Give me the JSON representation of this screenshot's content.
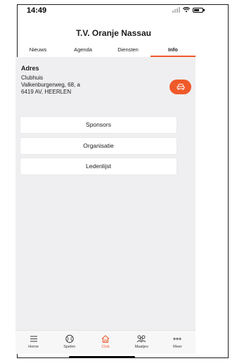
{
  "status_bar": {
    "time": "14:49"
  },
  "app": {
    "title": "T.V. Oranje Nassau"
  },
  "tabs": [
    {
      "label": "Nieuws",
      "active": false
    },
    {
      "label": "Agenda",
      "active": false
    },
    {
      "label": "Diensten",
      "active": false
    },
    {
      "label": "Info",
      "active": true
    }
  ],
  "address": {
    "title": "Adres",
    "line1": "Clubhuis",
    "line2": "Valkenburgerweg, 68, a",
    "line3": "6419 AV, HEERLEN"
  },
  "menu": {
    "sponsors": "Sponsors",
    "organisatie": "Organisatie",
    "ledenlijst": "Ledenlijst"
  },
  "tabbar": [
    {
      "label": "Home",
      "icon": "menu-icon"
    },
    {
      "label": "Spelen",
      "icon": "tennis-ball-icon"
    },
    {
      "label": "Club",
      "icon": "house-icon",
      "active": true
    },
    {
      "label": "Maatjes",
      "icon": "people-icon"
    },
    {
      "label": "Meer",
      "icon": "more-icon"
    }
  ],
  "colors": {
    "accent": "#ef5a2a",
    "background": "#efeff1"
  }
}
